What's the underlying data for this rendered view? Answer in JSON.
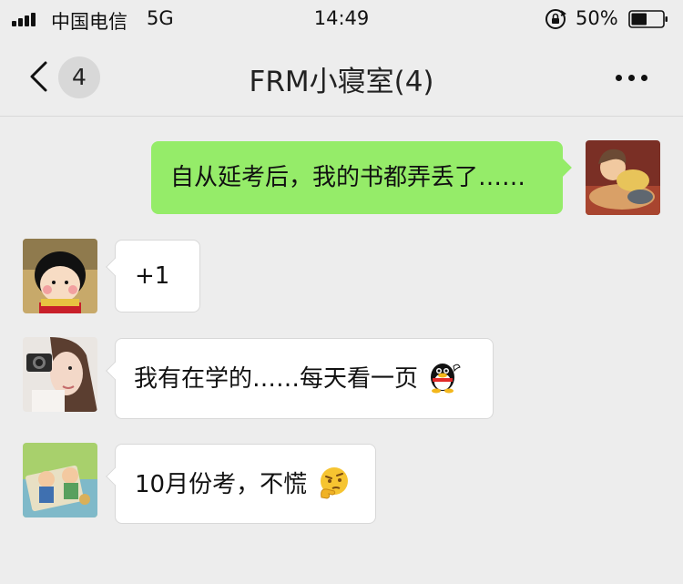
{
  "status_bar": {
    "carrier": "中国电信",
    "network": "5G",
    "time": "14:49",
    "battery": "50%",
    "battery_level": 0.5
  },
  "nav": {
    "unread_count": "4",
    "title": "FRM小寝室(4)",
    "back_icon": "chevron-left-icon",
    "more_icon": "more-dots-icon"
  },
  "messages": [
    {
      "sender": "self",
      "text": "自从延考后，我的书都弄丢了……",
      "emoji": null
    },
    {
      "sender": "member-1",
      "text": "+1",
      "emoji": null
    },
    {
      "sender": "member-2",
      "text": "我有在学的……每天看一页",
      "emoji": "qq-penguin-emoji"
    },
    {
      "sender": "member-3",
      "text": "10月份考，不慌",
      "emoji": "thinking-face-emoji"
    }
  ],
  "colors": {
    "background": "#ededed",
    "outgoing_bubble": "#95ec69",
    "incoming_bubble": "#ffffff"
  }
}
